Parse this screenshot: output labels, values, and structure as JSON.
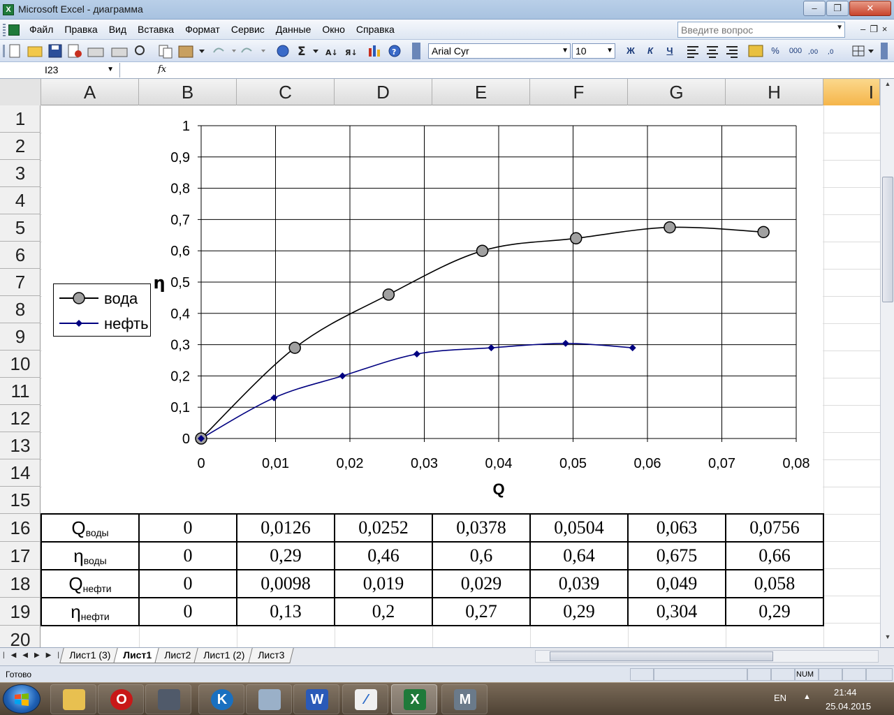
{
  "window": {
    "title": "Microsoft Excel - диаграмма",
    "minimize_symbol": "–",
    "maximize_symbol": "❐",
    "close_symbol": "✕"
  },
  "menu": {
    "items": [
      "Файл",
      "Правка",
      "Вид",
      "Вставка",
      "Формат",
      "Сервис",
      "Данные",
      "Окно",
      "Справка"
    ],
    "ask_placeholder": "Введите вопрос",
    "doc_buttons": "–❐×"
  },
  "toolbar": {
    "font_name": "Arial Cyr",
    "font_size": "10",
    "bold": "Ж",
    "italic": "К",
    "underline": "Ч",
    "sum": "Σ",
    "percent": "%",
    "thousands": "000"
  },
  "formula_bar": {
    "name_box": "I23",
    "fx": "fx"
  },
  "columns": [
    "A",
    "B",
    "C",
    "D",
    "E",
    "F",
    "G",
    "H",
    "I"
  ],
  "selected_column": "I",
  "rows": [
    "1",
    "2",
    "3",
    "4",
    "5",
    "6",
    "7",
    "8",
    "9",
    "10",
    "11",
    "12",
    "13",
    "14",
    "15",
    "16",
    "17",
    "18",
    "19",
    "20"
  ],
  "chart_data": {
    "type": "scatter",
    "xlabel": "Q",
    "ylabel": "η",
    "xlim": [
      0,
      0.08
    ],
    "ylim": [
      0,
      1
    ],
    "x_ticks": [
      "0",
      "0,01",
      "0,02",
      "0,03",
      "0,04",
      "0,05",
      "0,06",
      "0,07",
      "0,08"
    ],
    "y_ticks": [
      "0",
      "0,1",
      "0,2",
      "0,3",
      "0,4",
      "0,5",
      "0,6",
      "0,7",
      "0,8",
      "0,9",
      "1"
    ],
    "grid": true,
    "smoothed_lines": true,
    "legend_position": "left",
    "series": [
      {
        "name": "вода",
        "marker": "circle",
        "marker_color": "#a0a0a0",
        "line_color": "#000000",
        "x": [
          0,
          0.0126,
          0.0252,
          0.0378,
          0.0504,
          0.063,
          0.0756
        ],
        "y": [
          0,
          0.29,
          0.46,
          0.6,
          0.64,
          0.675,
          0.66
        ]
      },
      {
        "name": "нефть",
        "marker": "diamond",
        "marker_color": "#000080",
        "line_color": "#000080",
        "x": [
          0,
          0.0098,
          0.019,
          0.029,
          0.039,
          0.049,
          0.058
        ],
        "y": [
          0,
          0.13,
          0.2,
          0.27,
          0.29,
          0.304,
          0.29
        ]
      }
    ]
  },
  "table": {
    "rows": [
      {
        "label": "Q",
        "sub": "воды",
        "values": [
          "0",
          "0,0126",
          "0,0252",
          "0,0378",
          "0,0504",
          "0,063",
          "0,0756"
        ]
      },
      {
        "label": "η",
        "sub": "воды",
        "values": [
          "0",
          "0,29",
          "0,46",
          "0,6",
          "0,64",
          "0,675",
          "0,66"
        ]
      },
      {
        "label": "Q",
        "sub": "нефти",
        "values": [
          "0",
          "0,0098",
          "0,019",
          "0,029",
          "0,039",
          "0,049",
          "0,058"
        ]
      },
      {
        "label": "η",
        "sub": "нефти",
        "values": [
          "0",
          "0,13",
          "0,2",
          "0,27",
          "0,29",
          "0,304",
          "0,29"
        ]
      }
    ]
  },
  "sheet_tabs": [
    "Лист1 (3)",
    "Лист1",
    "Лист2",
    "Лист1 (2)",
    "Лист3"
  ],
  "active_tab": "Лист1",
  "status": {
    "text": "Готово",
    "num": "NUM"
  },
  "taskbar": {
    "lang": "EN",
    "time": "21:44",
    "date": "25.04.2015",
    "tray_arrow": "▲"
  }
}
